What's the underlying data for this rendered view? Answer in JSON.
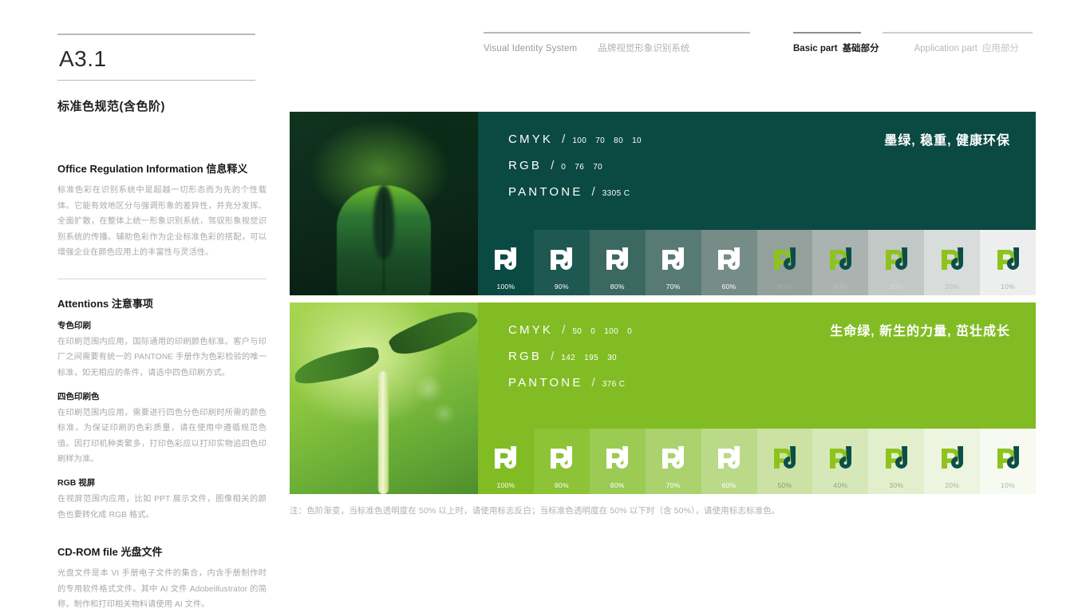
{
  "header": {
    "code": "A3.1",
    "system_en": "Visual Identity System",
    "system_cn": "品牌视觉形象识别系统",
    "nav": [
      {
        "en": "Basic part",
        "cn": "基础部分",
        "active": true
      },
      {
        "en": "Application part",
        "cn": "应用部分",
        "active": false
      }
    ]
  },
  "sidebar": {
    "title": "标准色规范(含色阶)",
    "info_heading": "Office Regulation Information 信息释义",
    "info_body": "标准色彩在识别系统中是超越一切形态而为先的个性载体。它能有效地区分与强调形象的差异性，并充分发挥、全面扩散，在整体上统一形象识别系统，驾驭形象视觉识别系统的传播。辅助色彩作为企业标准色彩的搭配，可以增强企业在颜色应用上的丰富性与灵活性。",
    "attentions_heading": "Attentions 注意事项",
    "attentions": [
      {
        "label": "专色印刷",
        "text": "在印刷范围内应用，国际通用的印刷颜色标准。客户与印厂之间需要有统一的 PANTONE 手册作为色彩检验的唯一标准，如无相应的条件，请选中四色印刷方式。"
      },
      {
        "label": "四色印刷色",
        "text": "在印刷范围内应用，需要进行四色分色印刷时所需的颜色标准，为保证印刷的色彩质量，请在使用中遵循规范色值。因打印机种类繁多，打印色彩应以打印实物追四色印刷样为准。"
      },
      {
        "label": "RGB 视屏",
        "text": "在视屏范围内应用，比如 PPT 展示文件，图像相关的颜色也要转化成 RGB 格式。"
      }
    ],
    "cdrom_heading": "CD-ROM file 光盘文件",
    "cdrom_body": "光盘文件是本 VI 手册电子文件的集合，内含手册制作时的专用软件格式文件。其中 AI 文件 Adobeillustrator 的简称，制作和打印相关物料请使用 AI 文件。"
  },
  "colors": [
    {
      "name": "primary-dark-green",
      "hex": "#004C46",
      "photo": "dark-leaf-photo",
      "tagline": "墨绿, 稳重, 健康环保",
      "specs": [
        {
          "key": "CMYK",
          "values": [
            "100",
            "70",
            "80",
            "10"
          ]
        },
        {
          "key": "RGB",
          "values": [
            "0",
            "76",
            "70"
          ]
        },
        {
          "key": "PANTONE",
          "values": [
            "3305 C"
          ]
        }
      ],
      "tints": [
        {
          "pct": "100%",
          "bg": "#0b4a42",
          "label_color": "#ffffff",
          "logo": "white"
        },
        {
          "pct": "90%",
          "bg": "#1d5951",
          "label_color": "#ffffff",
          "logo": "white"
        },
        {
          "pct": "80%",
          "bg": "#3b6962",
          "label_color": "#ffffff",
          "logo": "white"
        },
        {
          "pct": "70%",
          "bg": "#587a74",
          "label_color": "#ffffff",
          "logo": "white"
        },
        {
          "pct": "60%",
          "bg": "#768c87",
          "label_color": "#ffffff",
          "logo": "white"
        },
        {
          "pct": "50%",
          "bg": "#94a09c",
          "label_color": "#a7b2ae",
          "logo": "color"
        },
        {
          "pct": "40%",
          "bg": "#aab3b0",
          "label_color": "#bcc4c1",
          "logo": "color"
        },
        {
          "pct": "30%",
          "bg": "#c2c8c6",
          "label_color": "#d1d6d4",
          "logo": "color"
        },
        {
          "pct": "20%",
          "bg": "#d8dcda",
          "label_color": "#b9bfbd",
          "logo": "color"
        },
        {
          "pct": "10%",
          "bg": "#edefee",
          "label_color": "#aeb4b2",
          "logo": "color"
        }
      ]
    },
    {
      "name": "secondary-life-green",
      "hex": "#8EC31E",
      "photo": "sprout-photo",
      "tagline": "生命绿, 新生的力量, 茁壮成长",
      "specs": [
        {
          "key": "CMYK",
          "values": [
            "50",
            "0",
            "100",
            "0"
          ]
        },
        {
          "key": "RGB",
          "values": [
            "142",
            "195",
            "30"
          ]
        },
        {
          "key": "PANTONE",
          "values": [
            "376 C"
          ]
        }
      ],
      "tints": [
        {
          "pct": "100%",
          "bg": "#82bc24",
          "label_color": "#ffffff",
          "logo": "white"
        },
        {
          "pct": "90%",
          "bg": "#8dc337",
          "label_color": "#ffffff",
          "logo": "white"
        },
        {
          "pct": "80%",
          "bg": "#9ccb53",
          "label_color": "#ffffff",
          "logo": "white"
        },
        {
          "pct": "70%",
          "bg": "#abd26e",
          "label_color": "#ffffff",
          "logo": "white"
        },
        {
          "pct": "60%",
          "bg": "#bbda89",
          "label_color": "#ffffff",
          "logo": "white"
        },
        {
          "pct": "50%",
          "bg": "#cbe2a4",
          "label_color": "#8a9a77",
          "logo": "color"
        },
        {
          "pct": "40%",
          "bg": "#d6e8b8",
          "label_color": "#93a382",
          "logo": "color"
        },
        {
          "pct": "30%",
          "bg": "#e2efcc",
          "label_color": "#9cab8c",
          "logo": "color"
        },
        {
          "pct": "20%",
          "bg": "#edf4df",
          "label_color": "#a5b396",
          "logo": "color"
        },
        {
          "pct": "10%",
          "bg": "#f6faf0",
          "label_color": "#aeb9a1",
          "logo": "color"
        }
      ]
    }
  ],
  "footer_note": "注：色阶渐变，当标准色透明度在 50% 以上时，请使用标志反白；当标准色透明度在 50% 以下时（含 50%），请使用标志标准色。",
  "logo_colors": {
    "stem": "#8EC31E",
    "bowl": "#0C4E48",
    "reverse": "#ffffff"
  }
}
